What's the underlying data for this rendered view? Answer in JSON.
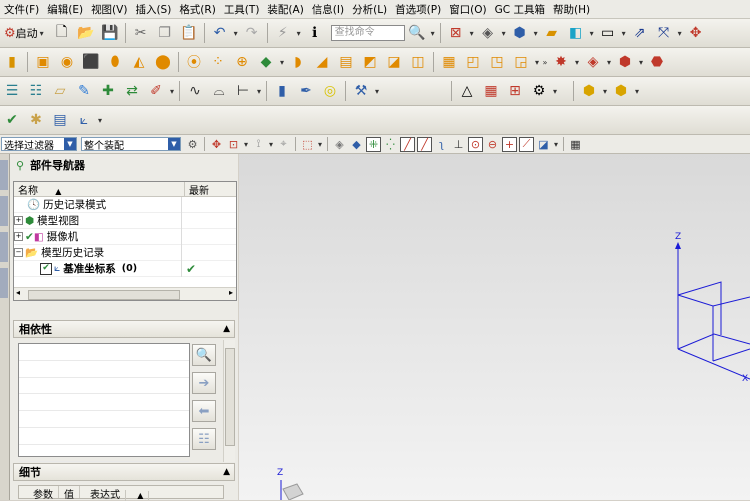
{
  "menu": [
    "文件(F)",
    "编辑(E)",
    "视图(V)",
    "插入(S)",
    "格式(R)",
    "工具(T)",
    "装配(A)",
    "信息(I)",
    "分析(L)",
    "首选项(P)",
    "窗口(O)",
    "GC 工具箱",
    "帮助(H)"
  ],
  "toolbar": {
    "start_label": "启动",
    "search_placeholder": "查找命令"
  },
  "filterbar": {
    "filter_value": "选择过滤器",
    "scope_value": "整个装配"
  },
  "navigator": {
    "title": "部件导航器",
    "col_name": "名称",
    "col_latest": "最新",
    "items": [
      {
        "label": "历史记录模式"
      },
      {
        "label": "模型视图"
      },
      {
        "label": "摄像机"
      },
      {
        "label": "模型历史记录"
      },
      {
        "label": "基准坐标系",
        "count": "(0)",
        "status": "✔"
      }
    ]
  },
  "dependencies": {
    "title": "相依性"
  },
  "details": {
    "title": "细节",
    "columns": [
      "参数",
      "值",
      "表达式"
    ]
  },
  "viewport": {
    "axis_z": "Z",
    "axis_x": "X",
    "mini_axis_z": "Z"
  }
}
